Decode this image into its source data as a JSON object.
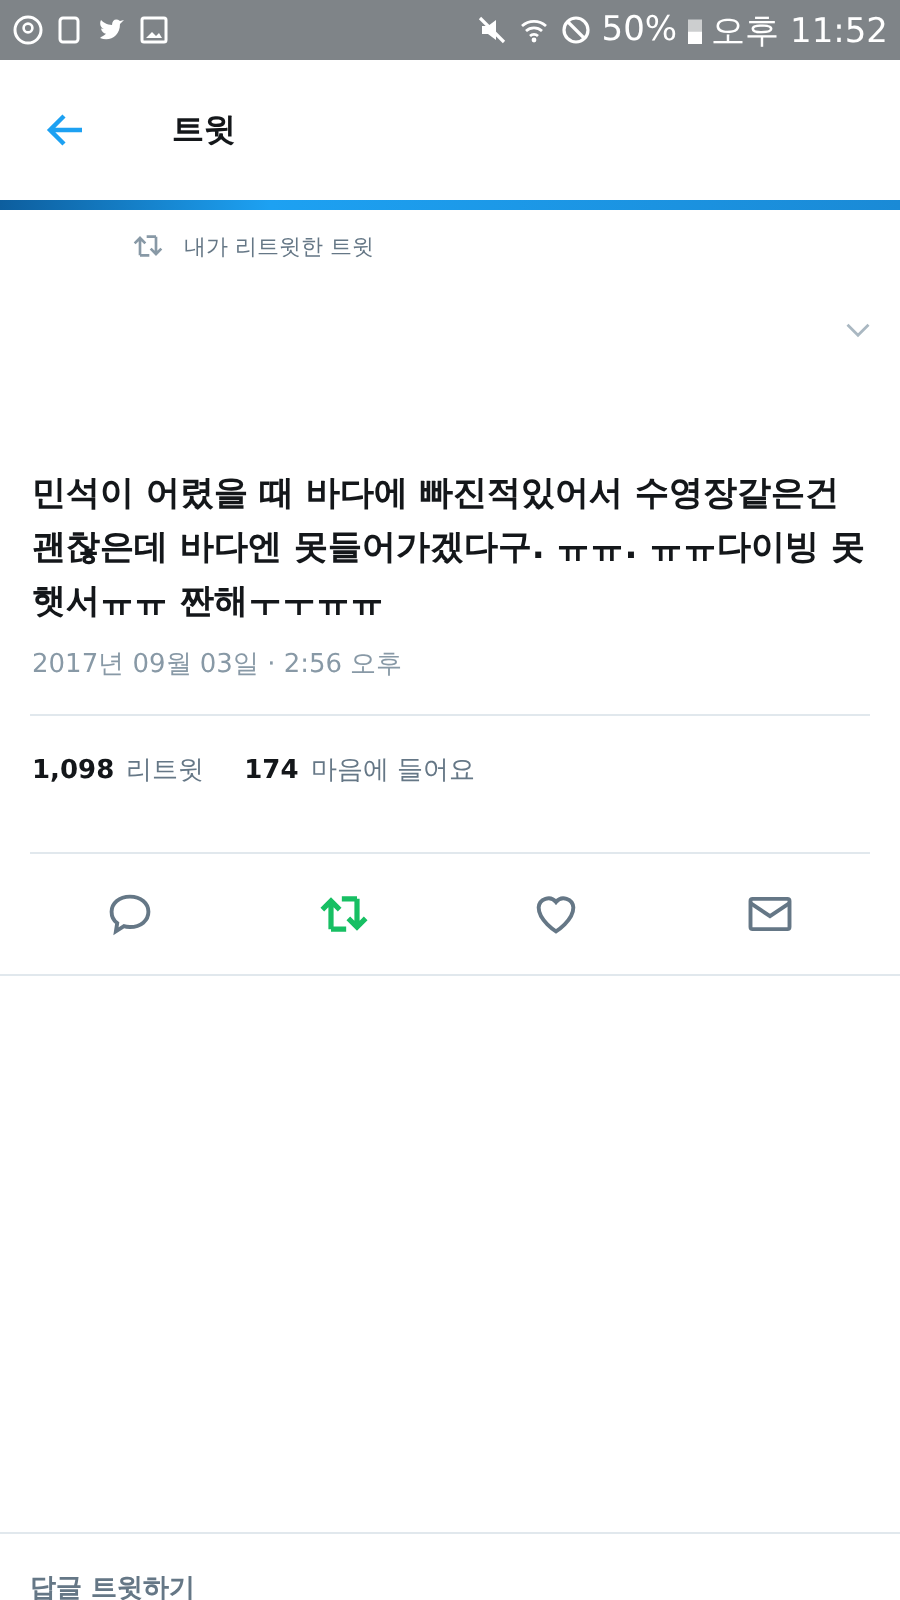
{
  "status_bar": {
    "battery": "50%",
    "time": "오후 11:52"
  },
  "app_bar": {
    "title": "트윗"
  },
  "retweet_context": "내가 리트윗한 트윗",
  "tweet": {
    "text": "민석이 어렸을 때 바다에 빠진적있어서 수영장같은건 괜찮은데 바다엔 못들어가겠다구. ㅠㅠ. ㅠㅠ다이빙 못햇서ㅠㅠ 짠해ㅜㅜㅠㅠ",
    "timestamp": "2017년 09월 03일 · 2:56 오후",
    "stats": [
      {
        "count": "1,098",
        "label": "리트윗"
      },
      {
        "count": "174",
        "label": "마음에 들어요"
      }
    ],
    "actions": [
      {
        "kind": "reply",
        "selected": false
      },
      {
        "kind": "retweet",
        "selected": true
      },
      {
        "kind": "like",
        "selected": false
      },
      {
        "kind": "message",
        "selected": false
      }
    ]
  },
  "reply_field": {
    "placeholder": "답글 트윗하기"
  }
}
